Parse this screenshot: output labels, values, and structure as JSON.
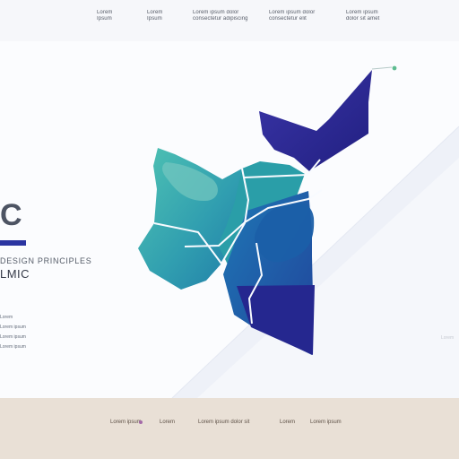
{
  "header": {
    "nav": [
      {
        "line1": "Lorem",
        "line2": "Ipsum"
      },
      {
        "line1": "Lorem",
        "line2": "Ipsum"
      },
      {
        "line1": "Lorem ipsum dolor",
        "line2": "consectetur adipiscing"
      },
      {
        "line1": "Lorem ipsum dolor",
        "line2": "consectetur elit"
      },
      {
        "line1": "Lorem ipsum",
        "line2": "dolor sit amet"
      }
    ]
  },
  "hero": {
    "letter": "C",
    "kicker": "DESIGN PRINCIPLES",
    "subtitle": "LMIC"
  },
  "details": [
    "Lorem",
    "Lorem ipsum",
    "Lorem ipsum",
    "Lorem ipsum"
  ],
  "illustration": {
    "colors": {
      "teal": "#38aeb0",
      "teal_light": "#72c6bf",
      "navy": "#2c2c94",
      "blue": "#1c6ab3",
      "green_dot": "#5ebc90"
    }
  },
  "side_note": "Lorem",
  "footer": {
    "links": [
      "Lorem ipsum",
      "Lorem",
      "Lorem ipsum dolor sit",
      "Lorem",
      "Lorem ipsum"
    ]
  }
}
